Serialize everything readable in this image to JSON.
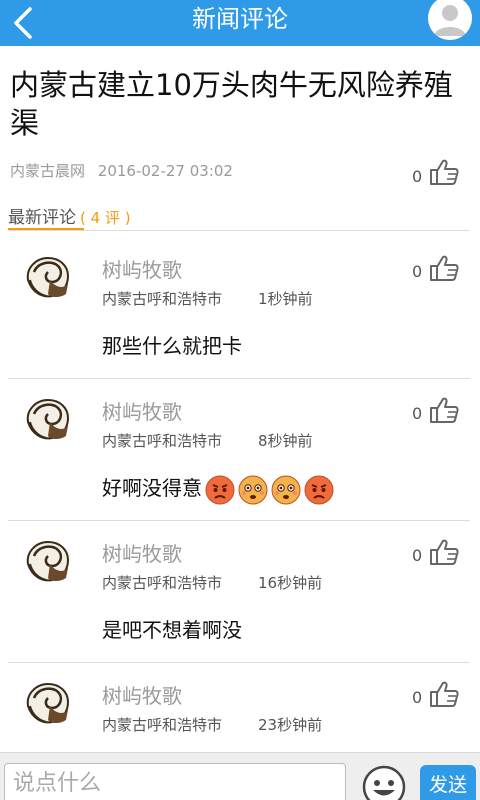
{
  "header": {
    "title": "新闻评论",
    "back_icon": "back-arrow-icon",
    "user_icon": "user-avatar-icon"
  },
  "article": {
    "title": "内蒙古建立10万头肉牛无风险养殖渠",
    "source": "内蒙古晨网",
    "datetime": "2016-02-27 03:02",
    "likes": "0"
  },
  "section": {
    "tab_label": "最新评论",
    "count_label": "( 4 评 )"
  },
  "comments": [
    {
      "name": "树屿牧歌",
      "location": "内蒙古呼和浩特市",
      "time": "1秒钟前",
      "text": "那些什么就把卡",
      "likes": "0",
      "emojis": []
    },
    {
      "name": "树屿牧歌",
      "location": "内蒙古呼和浩特市",
      "time": "8秒钟前",
      "text": "好啊没得意",
      "likes": "0",
      "emojis": [
        "angry-face-icon",
        "flushed-face-icon",
        "flushed-face-icon",
        "angry-face-icon"
      ]
    },
    {
      "name": "树屿牧歌",
      "location": "内蒙古呼和浩特市",
      "time": "16秒钟前",
      "text": "是吧不想着啊没",
      "likes": "0",
      "emojis": []
    },
    {
      "name": "树屿牧歌",
      "location": "内蒙古呼和浩特市",
      "time": "23秒钟前",
      "text": "",
      "likes": "0",
      "emojis": []
    }
  ],
  "composer": {
    "placeholder": "说点什么",
    "send_label": "发送",
    "emoji_icon": "smiley-face-icon"
  },
  "colors": {
    "primary": "#2f9be8",
    "accent": "#f39c12"
  }
}
